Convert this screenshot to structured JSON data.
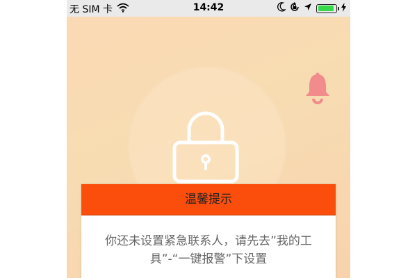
{
  "status_bar": {
    "carrier": "无 SIM 卡",
    "time": "14:42",
    "battery_level": 0.95,
    "icons": [
      "wifi-icon",
      "moon-icon",
      "rotation-lock-icon",
      "location-arrow-icon",
      "battery-icon",
      "charging-icon"
    ]
  },
  "main": {
    "lock_icon": "lock-icon",
    "bell_icon": "bell-icon"
  },
  "dialog": {
    "title": "温馨提示",
    "message": "你还未设置紧急联系人，请先去”我的工具”-“一键报警”下设置"
  },
  "colors": {
    "background_top": "#fbd9b4",
    "dialog_header": "#fb4e0d",
    "bell": "#f28b8b",
    "lock": "#ffffff",
    "battery": "#37d94a"
  }
}
